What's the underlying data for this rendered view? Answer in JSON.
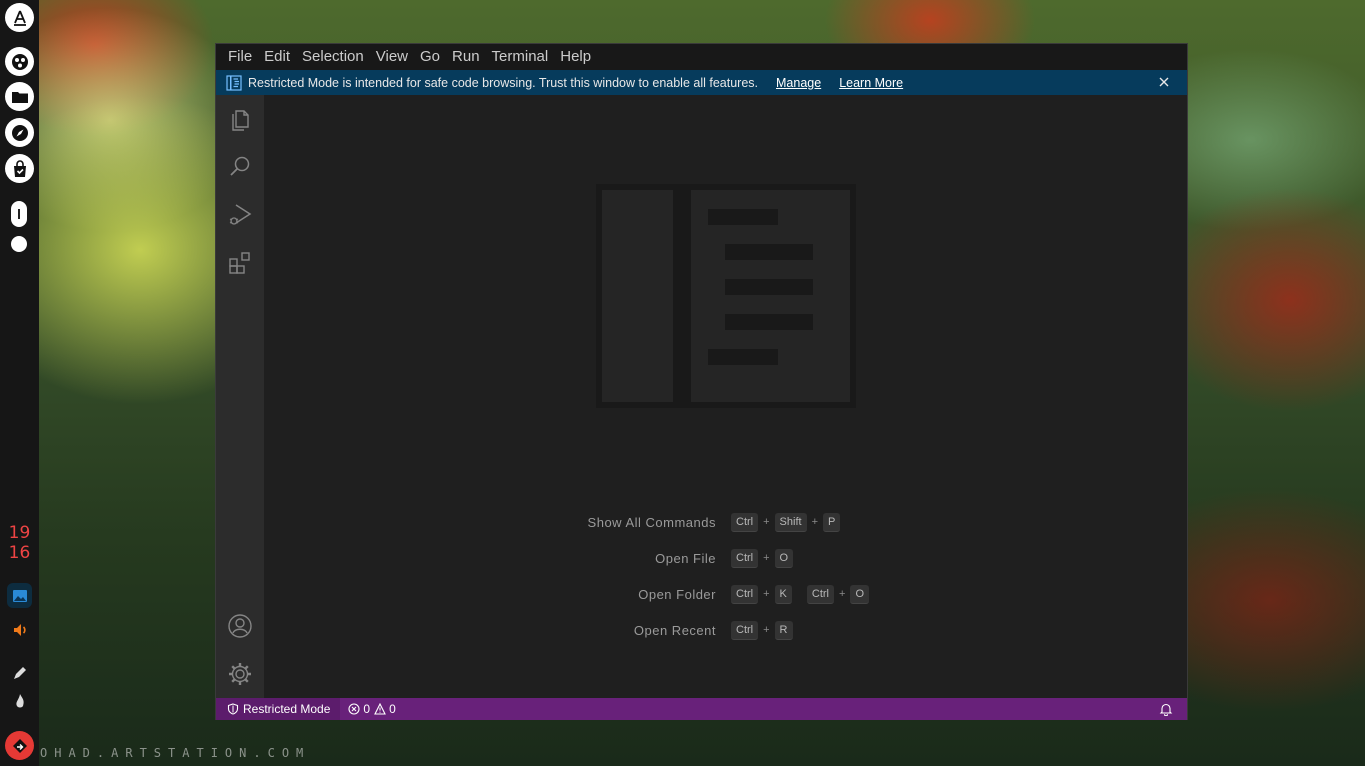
{
  "wallpaper": {
    "credit": "OHAD.ARTSTATION.COM"
  },
  "dock": {
    "items": [
      "app-store-icon",
      "apps-icon",
      "files-icon",
      "browser-icon",
      "store-bag-icon"
    ],
    "clock": {
      "hour": "19",
      "minute": "16"
    },
    "tray": [
      "image-viewer-icon",
      "volume-icon",
      "pen-icon",
      "flame-icon",
      "logout-icon"
    ],
    "accent": "#e53935"
  },
  "menubar": {
    "items": [
      "File",
      "Edit",
      "Selection",
      "View",
      "Go",
      "Run",
      "Terminal",
      "Help"
    ]
  },
  "banner": {
    "message": "Restricted Mode is intended for safe code browsing. Trust this window to enable all features.",
    "manage": "Manage",
    "learn_more": "Learn More",
    "background": "#063b5c"
  },
  "activitybar": {
    "top": [
      "explorer-icon",
      "search-icon",
      "run-debug-icon",
      "extensions-icon"
    ],
    "bottom": [
      "accounts-icon",
      "settings-gear-icon"
    ]
  },
  "shortcuts": [
    {
      "label": "Show All Commands",
      "keys": [
        [
          "Ctrl",
          "Shift",
          "P"
        ]
      ]
    },
    {
      "label": "Open File",
      "keys": [
        [
          "Ctrl",
          "O"
        ]
      ]
    },
    {
      "label": "Open Folder",
      "keys": [
        [
          "Ctrl",
          "K"
        ],
        [
          "Ctrl",
          "O"
        ]
      ]
    },
    {
      "label": "Open Recent",
      "keys": [
        [
          "Ctrl",
          "R"
        ]
      ]
    }
  ],
  "statusbar": {
    "restricted_label": "Restricted Mode",
    "errors": "0",
    "warnings": "0",
    "background": "#68217a"
  }
}
